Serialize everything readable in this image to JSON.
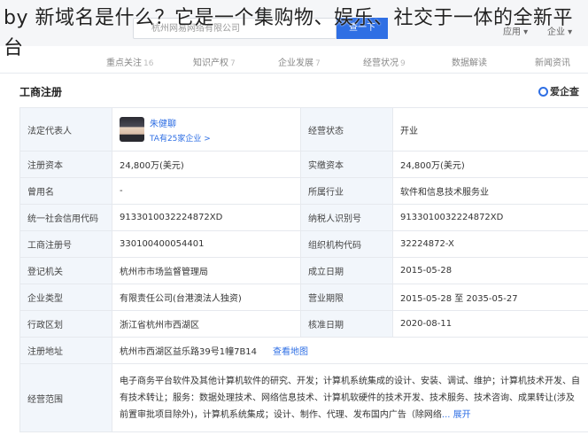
{
  "overlay_title": "by 新域名是什么？它是一个集购物、娱乐、社交于一体的全新平台",
  "top": {
    "search_placeholder": "杭州网易网络有限公司",
    "search_button": "查一下",
    "link_app": "应用 ▾",
    "link_enterprise": "企业 ▾"
  },
  "tabs": [
    {
      "label": "重点关注",
      "count": "16"
    },
    {
      "label": "知识产权",
      "count": "7"
    },
    {
      "label": "企业发展",
      "count": "7"
    },
    {
      "label": "经营状况",
      "count": "9"
    },
    {
      "label": "数据解读",
      "count": ""
    },
    {
      "label": "新闻资讯",
      "count": ""
    }
  ],
  "section": {
    "title": "工商注册",
    "brand": "爱企查"
  },
  "rep": {
    "label": "法定代表人",
    "name": "朱健聊",
    "sub": "TA有25家企业 >"
  },
  "rows": [
    {
      "l1": "经营状态",
      "v1": "开业"
    },
    {
      "l1": "注册资本",
      "v1": "24,800万(美元)",
      "l2": "实缴资本",
      "v2": "24,800万(美元)"
    },
    {
      "l1": "曾用名",
      "v1": "-",
      "l2": "所属行业",
      "v2": "软件和信息技术服务业"
    },
    {
      "l1": "统一社会信用代码",
      "v1": "9133010032224872XD",
      "l2": "纳税人识别号",
      "v2": "9133010032224872XD"
    },
    {
      "l1": "工商注册号",
      "v1": "330100400054401",
      "l2": "组织机构代码",
      "v2": "32224872-X"
    },
    {
      "l1": "登记机关",
      "v1": "杭州市市场监督管理局",
      "l2": "成立日期",
      "v2": "2015-05-28"
    },
    {
      "l1": "企业类型",
      "v1": "有限责任公司(台港澳法人独资)",
      "l2": "营业期限",
      "v2": "2015-05-28 至 2035-05-27"
    },
    {
      "l1": "行政区划",
      "v1": "浙江省杭州市西湖区",
      "l2": "核准日期",
      "v2": "2020-08-11"
    },
    {
      "l1": "注册地址",
      "v1": "杭州市西湖区益乐路39号1幢7B14",
      "link": "查看地图"
    }
  ],
  "scope": {
    "label": "经营范围",
    "text": "电子商务平台软件及其他计算机软件的研究、开发；计算机系统集成的设计、安装、调试、维护；计算机技术开发、自有技术转让；服务：数据处理技术、网络信息技术、计算机软硬件的技术开发、技术服务、技术咨询、成果转让(涉及前置审批项目除外)，计算机系统集成；设计、制作、代理、发布国内广告（除网络",
    "more": "... 展开"
  }
}
